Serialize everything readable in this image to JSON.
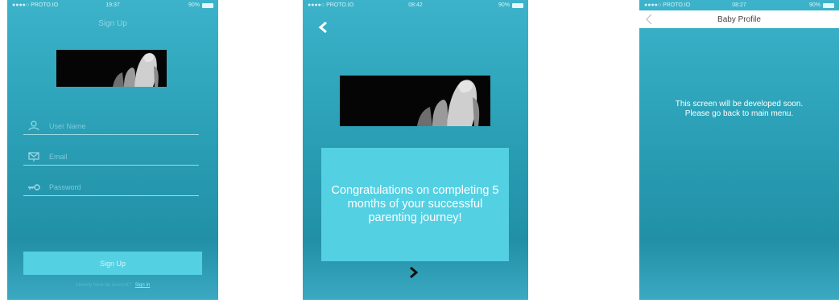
{
  "colors": {
    "accent": "#54d0e3",
    "gradient_top": "#3cb3ca",
    "gradient_bottom": "#2190a7",
    "image_bg": "#050505"
  },
  "screen_signup": {
    "status": {
      "carrier": "●●●●○ PROTO.IO",
      "time": "19:37",
      "battery": "90%"
    },
    "title": "Sign Up",
    "image_icon": "baby-hand-image",
    "fields": {
      "username": {
        "icon": "user-icon",
        "placeholder": "User Name",
        "value": ""
      },
      "email": {
        "icon": "email-icon",
        "placeholder": "Email",
        "value": ""
      },
      "password": {
        "icon": "key-icon",
        "placeholder": "Password",
        "value": ""
      }
    },
    "signup_label": "Sign Up",
    "footer_text": "Already have an account?",
    "signin_link": "Sign In"
  },
  "screen_congrats": {
    "status": {
      "carrier": "●●●●○ PROTO.IO",
      "time": "08:42",
      "battery": "90%"
    },
    "back_icon": "chevron-left-icon",
    "image_icon": "baby-hand-image",
    "message": "Congratulations on completing 5 months of your successful parenting journey!",
    "next_icon": "chevron-right-icon"
  },
  "screen_baby_profile": {
    "status": {
      "carrier": "●●●●○ PROTO.IO",
      "time": "08:27",
      "battery": "90%"
    },
    "nav_title": "Baby Profile",
    "back_icon": "chevron-left-icon",
    "message": "This screen will be developed soon. Please go back to main menu."
  }
}
